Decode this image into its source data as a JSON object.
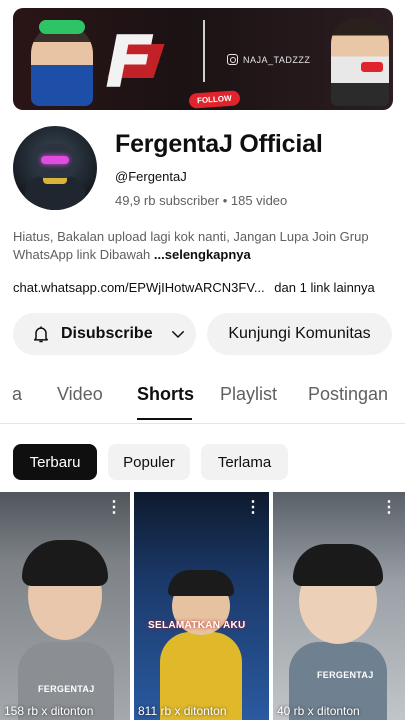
{
  "banner": {
    "logo_letter": "F",
    "instagram": "NAJA_TADZZZ",
    "follow_label": "FOLLOW"
  },
  "channel": {
    "name": "FergentaJ Official",
    "handle": "@FergentaJ",
    "subscribers": "49,9 rb subscriber",
    "videos": "185 video",
    "meta_separator": "•",
    "description_line1": "Hiatus, Bakalan upload lagi kok nanti, Jangan Lupa Join Grup",
    "description_line2": "WhatsApp link Dibawah",
    "more_label": "...selengkapnya",
    "link": "chat.whatsapp.com/EPWjIHotwARCN3FV...",
    "link_extra": "dan 1 link lainnya"
  },
  "actions": {
    "subscribe_label": "Disubscribe",
    "community_label": "Kunjungi Komunitas"
  },
  "tabs": [
    {
      "label": "a"
    },
    {
      "label": "Video"
    },
    {
      "label": "Shorts",
      "active": true
    },
    {
      "label": "Playlist"
    },
    {
      "label": "Postingan"
    }
  ],
  "chips": [
    {
      "label": "Terbaru",
      "active": true
    },
    {
      "label": "Populer"
    },
    {
      "label": "Terlama"
    }
  ],
  "shorts": [
    {
      "views": "158 rb x ditonton",
      "caption": "FERGENTAJ"
    },
    {
      "views": "811 rb x ditonton",
      "caption": "SELAMATKAN AKU"
    },
    {
      "views": "40 rb x ditonton",
      "caption": "FERGENTAJ"
    }
  ],
  "colors": {
    "text_primary": "#0f0f0f",
    "text_secondary": "#606060",
    "chip_bg": "#f2f2f2",
    "chip_active_bg": "#0f0f0f",
    "brand_red": "#e0242b"
  },
  "icons": {
    "subscribe_bell": "bell-icon",
    "subscribe_chevron": "chevron-down-icon",
    "short_menu": "more-vert-icon",
    "instagram": "instagram-icon"
  }
}
